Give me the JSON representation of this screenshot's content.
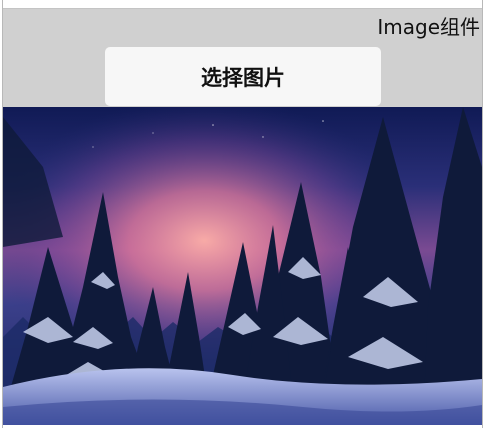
{
  "header": {
    "label": "Image组件"
  },
  "toolbar": {
    "pick_image_label": "选择图片"
  },
  "image": {
    "subject": "winter-forest-sunset-photo",
    "colors": {
      "sky_top": "#14205e",
      "sky_mid": "#6a4a9a",
      "glow": "#f08aa0",
      "snow": "#c8d2f0",
      "tree_dark": "#0f1a3a"
    }
  }
}
